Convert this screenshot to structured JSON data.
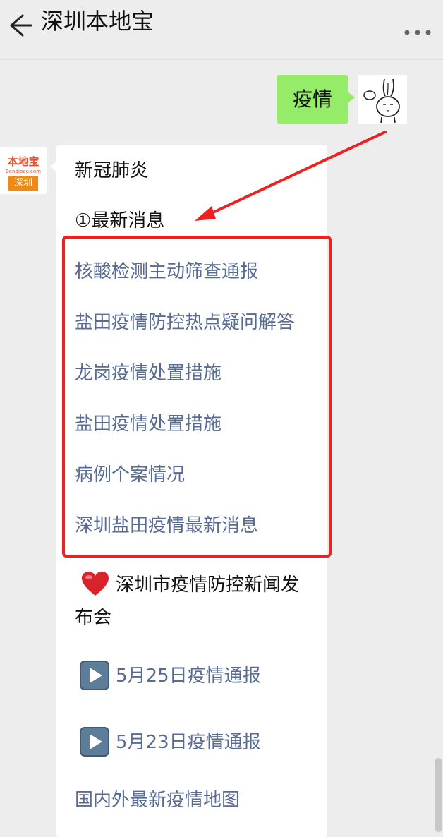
{
  "header": {
    "back_icon": "back-arrow-icon",
    "title": "深圳本地宝",
    "more_icon": "more-dots-icon"
  },
  "user_message": {
    "text": "疫情",
    "bubble_color": "#95ec69"
  },
  "bot": {
    "avatar": {
      "logo_text": "本地宝",
      "logo_sub": "Bendibao.com",
      "city": "深圳"
    },
    "lines": {
      "l1": "新冠肺炎",
      "l2": "①最新消息",
      "l3": "核酸检测主动筛查通报",
      "l4": "盐田疫情防控热点疑问解答",
      "l5": "龙岗疫情处置措施",
      "l6": "盐田疫情处置措施",
      "l7": "病例个案情况",
      "l8": "深圳盐田疫情最新消息",
      "l9a": "深圳市疫情防控新闻发",
      "l9b": "布会",
      "l10": "5月25日疫情通报",
      "l11": "5月23日疫情通报",
      "l12": "国内外最新疫情地图"
    },
    "icons": {
      "heart": "heart-icon",
      "play": "play-button-icon"
    }
  },
  "colors": {
    "link": "#576b95",
    "highlight_box": "#f02020",
    "annotation_arrow": "#f02020",
    "background": "#ededed"
  }
}
